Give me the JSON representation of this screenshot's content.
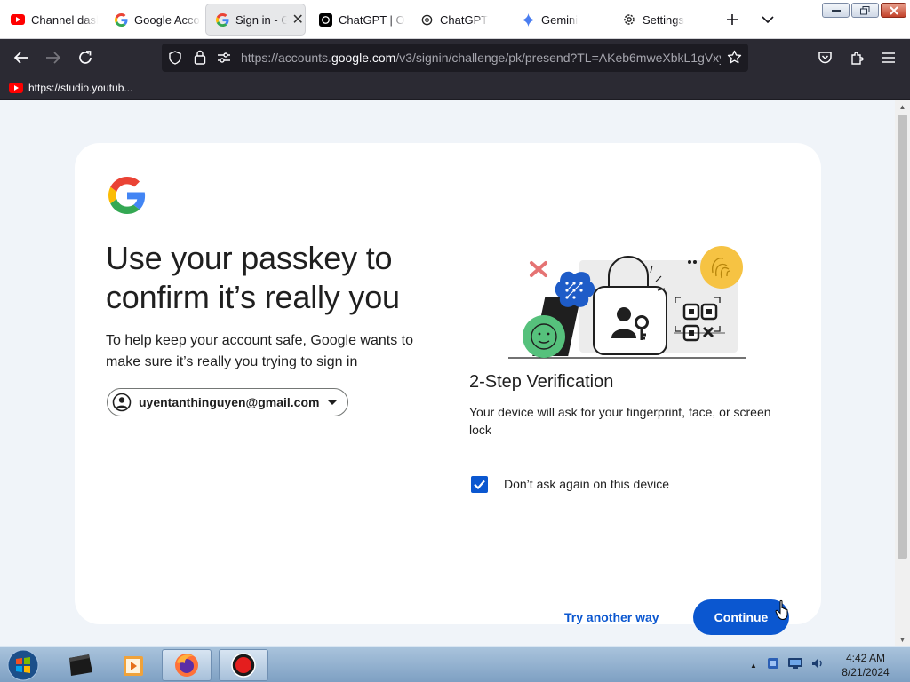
{
  "browser": {
    "tabs": [
      {
        "label": "Channel dash",
        "icon": "youtube-icon",
        "active": false
      },
      {
        "label": "Google Acco",
        "icon": "google-icon",
        "active": false
      },
      {
        "label": "Sign in - G",
        "icon": "google-icon",
        "active": true
      },
      {
        "label": "ChatGPT | Op",
        "icon": "chatgpt-icon",
        "active": false
      },
      {
        "label": "ChatGPT",
        "icon": "chatgpt-icon",
        "active": false
      },
      {
        "label": "Gemini",
        "icon": "gemini-icon",
        "active": false
      },
      {
        "label": "Settings",
        "icon": "gear-icon",
        "active": false
      }
    ],
    "url": {
      "prefix": "https://accounts.",
      "host": "google.com",
      "path": "/v3/signin/challenge/pk/presend?TL=AKeb6mweXbkL1gVxy"
    },
    "bookmark": {
      "label": "https://studio.youtub...",
      "icon": "youtube-icon"
    }
  },
  "page": {
    "heading": "Use your passkey to confirm it’s really you",
    "subtext": "To help keep your account safe, Google wants to make sure it’s really you trying to sign in",
    "account_email": "uyentanthinguyen@gmail.com",
    "section_title": "2-Step Verification",
    "section_desc": "Your device will ask for your fingerprint, face, or screen lock",
    "checkbox_label": "Don’t ask again on this device",
    "checkbox_checked": true,
    "try_another": "Try another way",
    "continue": "Continue"
  },
  "taskbar": {
    "time": "4:42 AM",
    "date": "8/21/2024"
  },
  "colors": {
    "primary": "#0b57d0",
    "page_bg": "#f0f4f9",
    "browser_dark": "#2b2a33"
  }
}
